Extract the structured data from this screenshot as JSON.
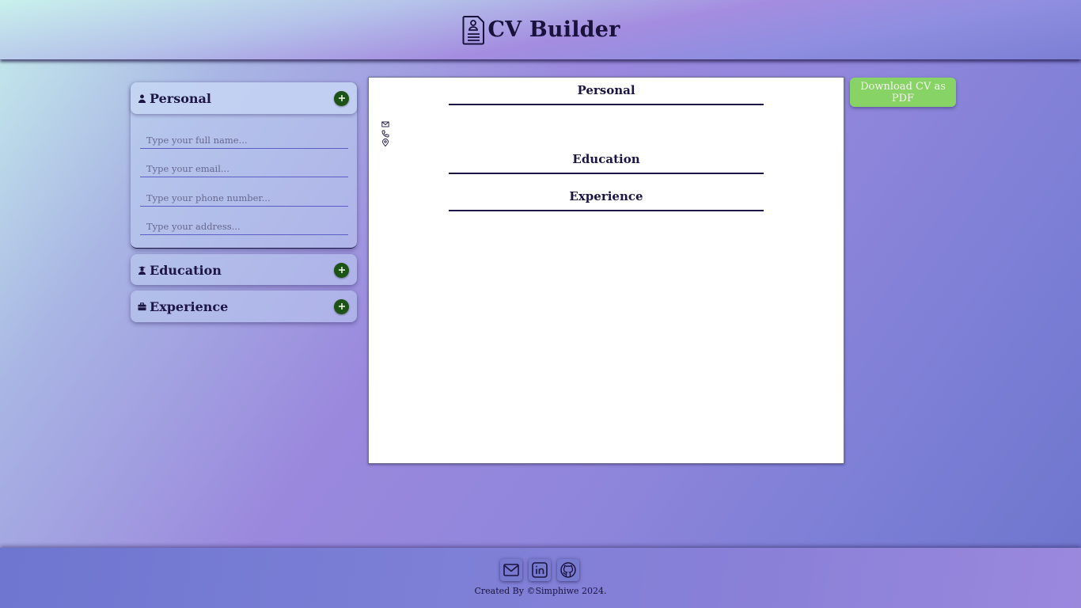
{
  "app": {
    "title": "CV Builder",
    "icon": "resume-document-icon"
  },
  "sidebar": {
    "sections": [
      {
        "title": "Personal",
        "icon": "person-icon",
        "expanded": true
      },
      {
        "title": "Education",
        "icon": "graduate-icon",
        "expanded": false
      },
      {
        "title": "Experience",
        "icon": "briefcase-icon",
        "expanded": false
      }
    ],
    "personal_fields": {
      "name_placeholder": "Type your full name...",
      "email_placeholder": "Type your email...",
      "phone_placeholder": "Type your phone number...",
      "address_placeholder": "Type your address..."
    }
  },
  "cv_preview": {
    "personal_heading": "Personal",
    "education_heading": "Education",
    "experience_heading": "Experience",
    "contact_icons": [
      "email-icon",
      "phone-icon",
      "location-icon"
    ]
  },
  "download_button": {
    "label": "Download CV as PDF",
    "color": "#88d365"
  },
  "footer": {
    "social_icons": [
      "email-icon",
      "linkedin-icon",
      "github-icon"
    ],
    "credit": "Created By ©Simphiwe 2024."
  },
  "colors": {
    "add_button": "#1c5418",
    "text": "#1a1440",
    "input_underline": "#5b5fc4"
  }
}
